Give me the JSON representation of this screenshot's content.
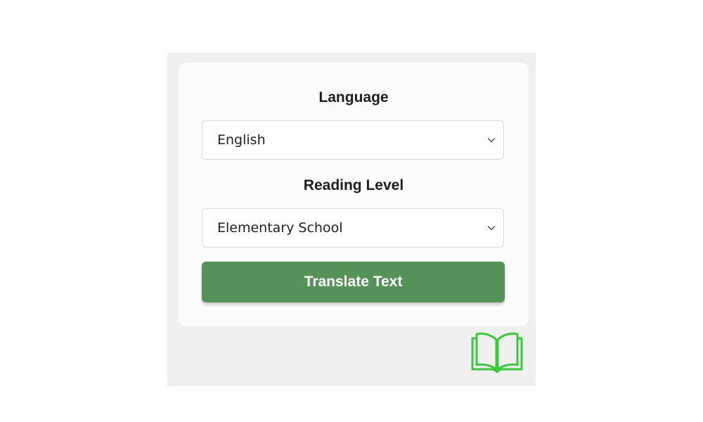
{
  "form": {
    "language_label": "Language",
    "language_value": "English",
    "reading_level_label": "Reading Level",
    "reading_level_value": "Elementary School",
    "translate_button_label": "Translate Text"
  },
  "icons": {
    "dropdown": "chevron-down-icon",
    "logo": "open-book-icon"
  },
  "colors": {
    "accent": "#55925a",
    "logo": "#3cc83c",
    "panel_background": "#f0f0f0",
    "card_background": "#fcfcfc"
  }
}
